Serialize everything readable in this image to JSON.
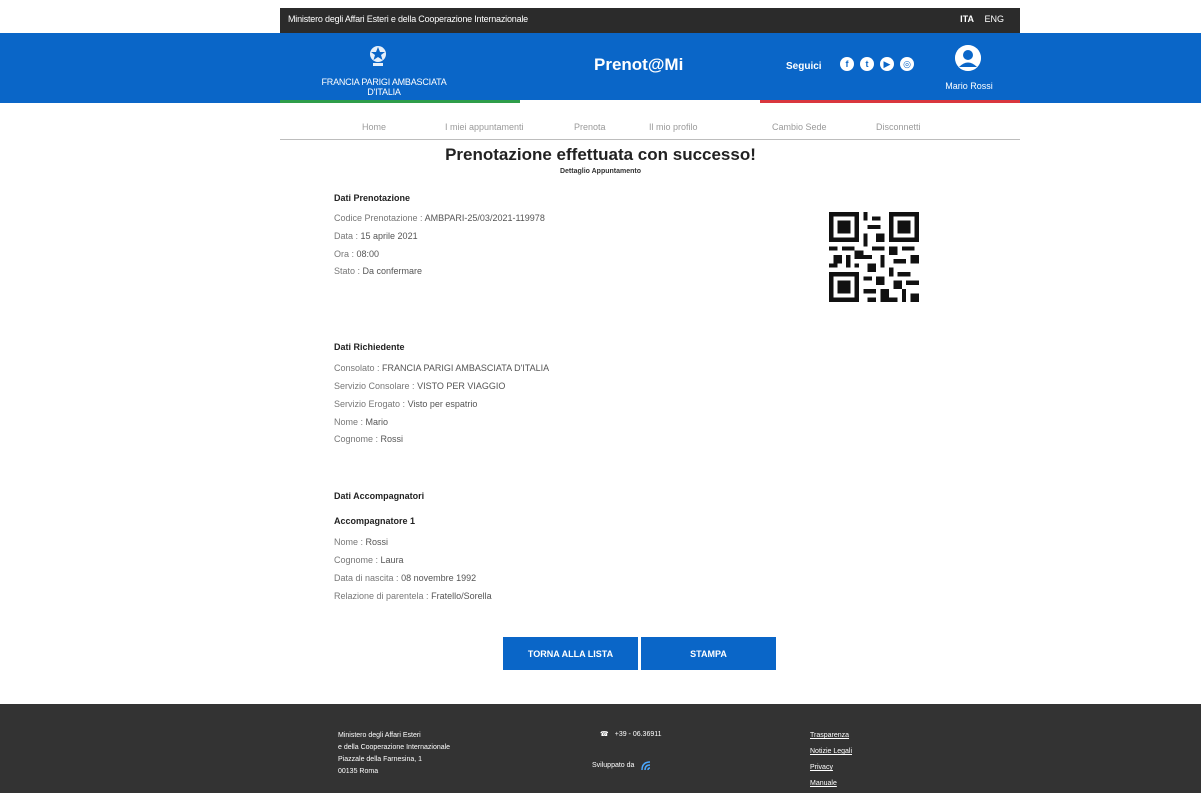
{
  "topbar": {
    "ministry": "Ministero degli Affari Esteri e della Cooperazione Internazionale",
    "languages": [
      {
        "label": "ITA",
        "active": true
      },
      {
        "label": "ENG",
        "active": false
      }
    ]
  },
  "header": {
    "embassy_line1": "FRANCIA PARIGI AMBASCIATA",
    "embassy_line2": "D'ITALIA",
    "brand": "Prenot@Mi",
    "follow_label": "Seguici",
    "socials": [
      "facebook-icon",
      "twitter-icon",
      "youtube-icon",
      "instagram-icon"
    ],
    "user_name": "Mario Rossi",
    "colors": {
      "primary": "#0a66c8",
      "green": "#2e9d4a",
      "red": "#d9363e"
    }
  },
  "nav": {
    "items": [
      "Home",
      "I miei appuntamenti",
      "Prenota",
      "Il mio profilo",
      "Cambio Sede",
      "Disconnetti"
    ]
  },
  "main": {
    "title": "Prenotazione effettuata con successo!",
    "subtitle": "Dettaglio Appuntamento",
    "booking": {
      "title": "Dati Prenotazione",
      "rows": [
        {
          "label": "Codice Prenotazione :",
          "value": "AMBPARI-25/03/2021-119978"
        },
        {
          "label": "Data :",
          "value": "15 aprile 2021"
        },
        {
          "label": "Ora :",
          "value": "08:00"
        },
        {
          "label": "Stato :",
          "value": "Da confermare"
        }
      ]
    },
    "applicant": {
      "title": "Dati Richiedente",
      "rows": [
        {
          "label": "Consolato :",
          "value": "FRANCIA PARIGI AMBASCIATA D'ITALIA"
        },
        {
          "label": "Servizio Consolare :",
          "value": "VISTO PER VIAGGIO"
        },
        {
          "label": "Servizio Erogato :",
          "value": "Visto per espatrio"
        },
        {
          "label": "Nome :",
          "value": "Mario"
        },
        {
          "label": "Cognome :",
          "value": "Rossi"
        }
      ]
    },
    "companions": {
      "title": "Dati Accompagnatori",
      "subtitle": "Accompagnatore 1",
      "rows": [
        {
          "label": "Nome :",
          "value": "Rossi"
        },
        {
          "label": "Cognome :",
          "value": "Laura"
        },
        {
          "label": "Data di nascita :",
          "value": "08 novembre 1992"
        },
        {
          "label": "Relazione di parentela :",
          "value": "Fratello/Sorella"
        }
      ]
    },
    "buttons": {
      "back": "TORNA ALLA LISTA",
      "print": "STAMPA"
    }
  },
  "footer": {
    "address": [
      "Ministero degli Affari Esteri",
      "e della Cooperazione Internazionale",
      "Piazzale della Farnesina, 1",
      "00135 Roma"
    ],
    "phone": "+39 - 06.36911",
    "developed_by": "Sviluppato da",
    "links": [
      "Trasparenza",
      "Notizie Legali",
      "Privacy",
      "Manuale"
    ]
  }
}
